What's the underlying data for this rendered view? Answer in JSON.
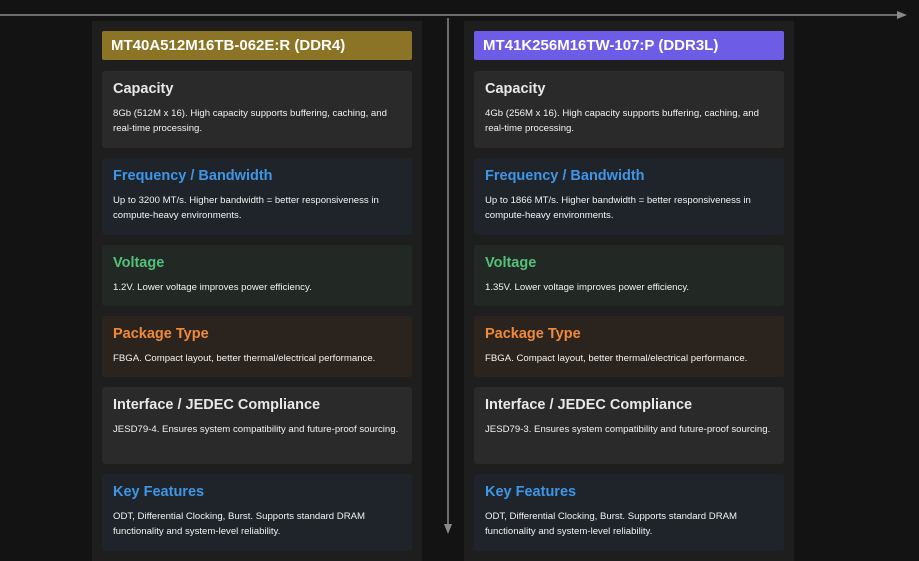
{
  "colors": {
    "ddr4_header": "#8b7425",
    "ddr3l_header": "#6d5ce6",
    "capacity": "#e8e8e8",
    "frequency": "#3f95e6",
    "voltage": "#55c07a",
    "package": "#ef8a3a",
    "interface": "#e8e8e8",
    "features": "#3f95e6"
  },
  "left": {
    "title": "MT40A512M16TB-062E:R (DDR4)",
    "capacity": {
      "title": "Capacity",
      "body": "8Gb (512M x 16). High capacity supports buffering, caching, and real-time processing."
    },
    "frequency": {
      "title": "Frequency / Bandwidth",
      "body": "Up to 3200 MT/s. Higher bandwidth = better responsiveness in compute-heavy environments."
    },
    "voltage": {
      "title": "Voltage",
      "body": "1.2V. Lower voltage improves power efficiency."
    },
    "package": {
      "title": "Package Type",
      "body": "FBGA. Compact layout, better thermal/electrical performance."
    },
    "interface": {
      "title": "Interface / JEDEC Compliance",
      "body": "JESD79-4. Ensures system compatibility and future-proof sourcing."
    },
    "features": {
      "title": "Key Features",
      "body": "ODT, Differential Clocking, Burst. Supports standard DRAM functionality and system-level reliability."
    }
  },
  "right": {
    "title": "MT41K256M16TW-107:P (DDR3L)",
    "capacity": {
      "title": "Capacity",
      "body": "4Gb (256M x 16). High capacity supports buffering, caching, and real-time processing."
    },
    "frequency": {
      "title": "Frequency / Bandwidth",
      "body": "Up to 1866 MT/s. Higher bandwidth = better responsiveness in compute-heavy environments."
    },
    "voltage": {
      "title": "Voltage",
      "body": "1.35V. Lower voltage improves power efficiency."
    },
    "package": {
      "title": "Package Type",
      "body": "FBGA. Compact layout, better thermal/electrical performance."
    },
    "interface": {
      "title": "Interface / JEDEC Compliance",
      "body": "JESD79-3. Ensures system compatibility and future-proof sourcing."
    },
    "features": {
      "title": "Key Features",
      "body": "ODT, Differential Clocking, Burst. Supports standard DRAM functionality and system-level reliability."
    }
  }
}
